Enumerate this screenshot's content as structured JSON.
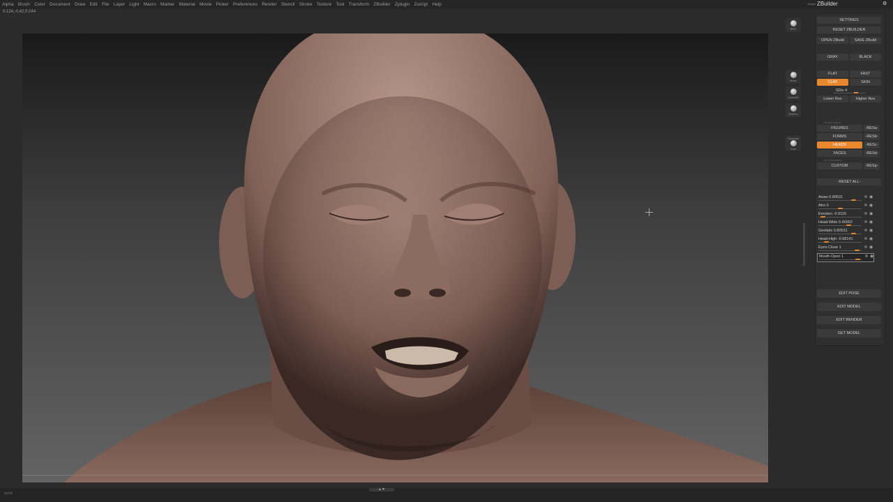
{
  "menubar": {
    "items": [
      "Alpha",
      "Brush",
      "Color",
      "Document",
      "Draw",
      "Edit",
      "File",
      "Layer",
      "Light",
      "Macro",
      "Marker",
      "Material",
      "Movie",
      "Picker",
      "Preferences",
      "Render",
      "Stencil",
      "Stroke",
      "Texture",
      "Tool",
      "Transform",
      "ZBuilder",
      "Zplugin",
      "Zscript",
      "Help"
    ]
  },
  "status": {
    "coords": "0.124,-0.42,0.044"
  },
  "toolbar": {
    "bpr_label": "BPR",
    "move_label": "Move",
    "zoom_label": "Zoom3D",
    "rotate_label": "RotFrm",
    "solo_label": "Solo",
    "dynamic_label": "Dynamic"
  },
  "panel": {
    "title": "ZBuilder",
    "pre_label": "plugin",
    "close_icon": "close-icon",
    "settings": "SETTINGS",
    "reset_zbuilder": "RESET ZBUILDER",
    "open_zbuild": "OPEN ZBuild",
    "save_zbuild": "SAVE ZBuild",
    "gray": "GRAY",
    "black": "BLACK",
    "flat": "FLAT",
    "fast": "FAST",
    "clay": "CLAY",
    "skin": "SKIN",
    "sdiv": "SDiv 4",
    "lower_res": "Lower Res",
    "higher_res": "Higher Res",
    "human_bases": "human bases",
    "figures": "FIGURES",
    "figures_res": "-RESa-",
    "forms": "FORMS",
    "forms_res": "-RESb-",
    "heads": "HEADS",
    "heads_res": "-RESc-",
    "faces": "FACES",
    "faces_res": "-RESd-",
    "our_characters": "our characters",
    "custom": "CUSTOM",
    "custom_res": "-RESp-",
    "reset_all": "-RESET ALL-",
    "sliders": [
      {
        "label": "Asian",
        "value": "0.80531",
        "knob": 0.85
      },
      {
        "label": "Afro",
        "value": "0",
        "knob": 0.5
      },
      {
        "label": "Emotion",
        "value": "-0.9115",
        "knob": 0.05
      },
      {
        "label": "Head-Wide",
        "value": "0.46902",
        "knob": 0.72
      },
      {
        "label": "Genitals",
        "value": "0.80531",
        "knob": 0.85
      },
      {
        "label": "Head-High",
        "value": "-0.68141",
        "knob": 0.15
      },
      {
        "label": "Eyes-Close",
        "value": "1",
        "knob": 0.95
      },
      {
        "label": "Mouth-Open",
        "value": "1",
        "knob": 0.95
      }
    ],
    "edit_pose": "EDIT POSE",
    "edit_model": "EDIT MODEL",
    "edit_render": "EDIT RENDER",
    "get_model": "GET MODEL"
  },
  "bottom": {
    "label": "scroll"
  },
  "colors": {
    "accent": "#e8872e",
    "panel_bg": "#2f2f2f",
    "menubar_bg": "#262626"
  }
}
